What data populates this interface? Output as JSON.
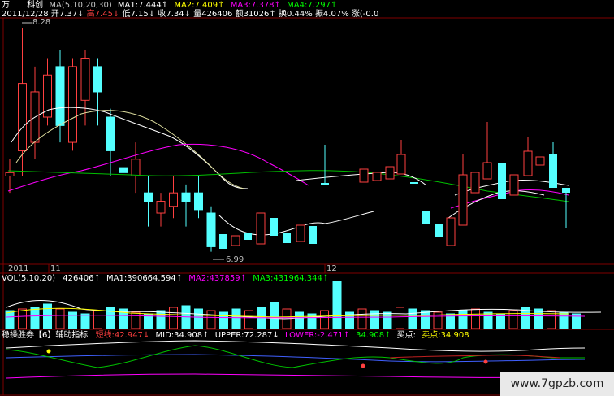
{
  "header": {
    "name_prefix": "万",
    "name": "科创",
    "ma_label": "MA(5,10,20,30)",
    "ma1": "MA1:7.444↑",
    "ma2": "MA2:7.409↑",
    "ma3": "MA3:7.378↑",
    "ma4": "MA4:7.297↑"
  },
  "quote": {
    "date": "2011/12/28",
    "open": "开7.37↓",
    "high": "高7.45↓",
    "low": "低7.15↓",
    "close": "收7.34↓",
    "vol": "量426406",
    "amount": "额31026↑",
    "turnover": "换0.44%",
    "amplitude": "振4.07%",
    "change": "涨(-0.0"
  },
  "price_panel": {
    "high_mark": "8.28",
    "low_mark": "6.99",
    "x_axis": [
      "2011",
      "11",
      "12"
    ]
  },
  "vol_panel": {
    "title": "VOL(5,10,20)",
    "vol": "426406↑",
    "ma1": "MA1:390664.594↑",
    "ma2": "MA2:437859↑",
    "ma3": "MA3:431964.344↑"
  },
  "indicator": {
    "title": "稳操胜券【6】辅助指标",
    "short": "短线:42.947↓",
    "mid": "MID:34.908↑",
    "upper": "UPPER:72.287↓",
    "lower": "LOWER:-2.471↑",
    "v5": "34.908↑",
    "buy": "买点:",
    "sell": "卖点:34.908"
  },
  "watermark": "www.7gpzb.com",
  "colors": {
    "up": "#ff4040",
    "down": "#54ffff",
    "ma1": "#ffffff",
    "ma2": "#ffff00",
    "ma3": "#ff00ff",
    "ma4": "#00c000",
    "grid": "#800000"
  },
  "candles": [
    {
      "o": 7.4,
      "c": 7.42,
      "h": 7.5,
      "l": 7.3
    },
    {
      "o": 7.55,
      "c": 7.95,
      "h": 8.28,
      "l": 7.4
    },
    {
      "o": 7.6,
      "c": 7.9,
      "h": 8.05,
      "l": 7.5
    },
    {
      "o": 7.75,
      "c": 8.0,
      "h": 8.1,
      "l": 7.7
    },
    {
      "o": 8.05,
      "c": 7.7,
      "h": 8.15,
      "l": 7.6
    },
    {
      "o": 7.6,
      "c": 8.05,
      "h": 8.1,
      "l": 7.55
    },
    {
      "o": 7.85,
      "c": 8.1,
      "h": 8.15,
      "l": 7.7
    },
    {
      "o": 8.05,
      "c": 7.9,
      "h": 8.1,
      "l": 7.7
    },
    {
      "o": 7.75,
      "c": 7.55,
      "h": 7.8,
      "l": 7.4
    },
    {
      "o": 7.45,
      "c": 7.42,
      "h": 7.6,
      "l": 7.2
    },
    {
      "o": 7.4,
      "c": 7.5,
      "h": 7.6,
      "l": 7.3
    },
    {
      "o": 7.3,
      "c": 7.25,
      "h": 7.4,
      "l": 7.1
    },
    {
      "o": 7.18,
      "c": 7.25,
      "h": 7.3,
      "l": 7.1
    },
    {
      "o": 7.22,
      "c": 7.3,
      "h": 7.4,
      "l": 7.15
    },
    {
      "o": 7.3,
      "c": 7.25,
      "h": 7.35,
      "l": 7.1
    },
    {
      "o": 7.3,
      "c": 7.2,
      "h": 7.4,
      "l": 7.15
    },
    {
      "o": 7.18,
      "c": 6.98,
      "h": 7.22,
      "l": 6.95
    }
  ]
}
